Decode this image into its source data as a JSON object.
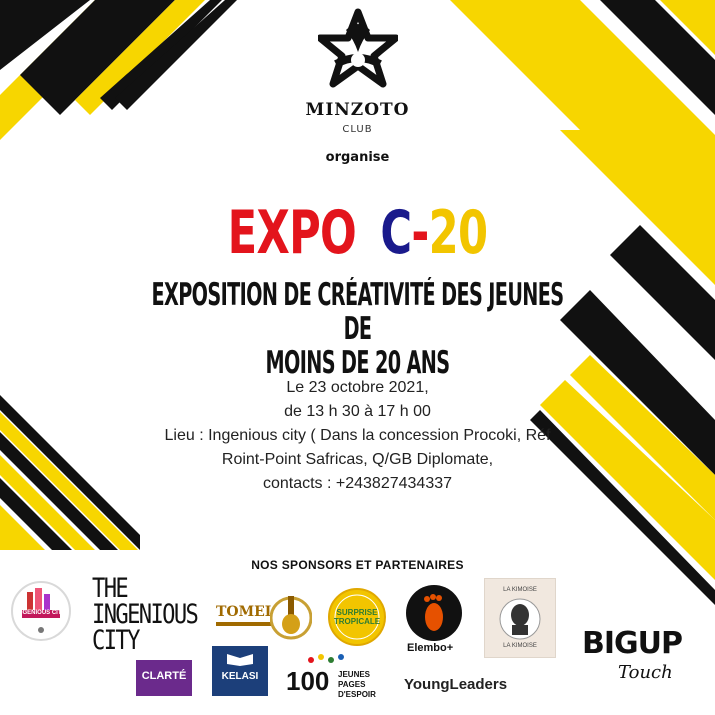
{
  "organizer": {
    "name": "MINZOTO",
    "sub": "CLUB",
    "action": "organise"
  },
  "event": {
    "title_part1": "EXPO",
    "title_part2": "C",
    "title_part3": "-",
    "title_part4": "20",
    "subtitle_line1": "EXPOSITION DE CRÉATIVITÉ DES JEUNES DE",
    "subtitle_line2": "MOINS DE 20 ANS"
  },
  "details": {
    "date": "Le 23 octobre 2021,",
    "time": "de 13 h 30 à 17 h 00",
    "location_line1": "Lieu : Ingenious city ( Dans la concession Procoki, Réf",
    "location_line2": "Roint-Point Safricas, Q/GB Diplomate,",
    "contacts": "contacts : +243827434337"
  },
  "sponsors": {
    "heading": "NOS SPONSORS ET PARTENAIRES",
    "ingenious_badge": "INGENIOUS CITY",
    "ingenious_line1": "THE",
    "ingenious_line2": "INGENIOUS",
    "ingenious_line3": "CITY",
    "tomela": "TOMELA",
    "surprise_line1": "SURPRISE",
    "surprise_line2": "TROPICALE",
    "elembo": "Elembo+",
    "la_kimoise_top": "LA KIMOISE",
    "la_kimoise_bottom": "LA KIMOISE",
    "clarte": "CLARTÉ",
    "kelasi": "KELASI",
    "hundred": "100",
    "jeunes_line1": "JEUNES PAGES",
    "jeunes_line2": "D'ESPOIR",
    "youngleaders": "YoungLeaders",
    "bigup_line1": "BIGUP",
    "bigup_line2": "Touch"
  },
  "colors": {
    "yellow": "#f7d600",
    "black": "#111111",
    "red": "#e3141c",
    "blue": "#1a1a8c",
    "gold": "#f2c500"
  }
}
